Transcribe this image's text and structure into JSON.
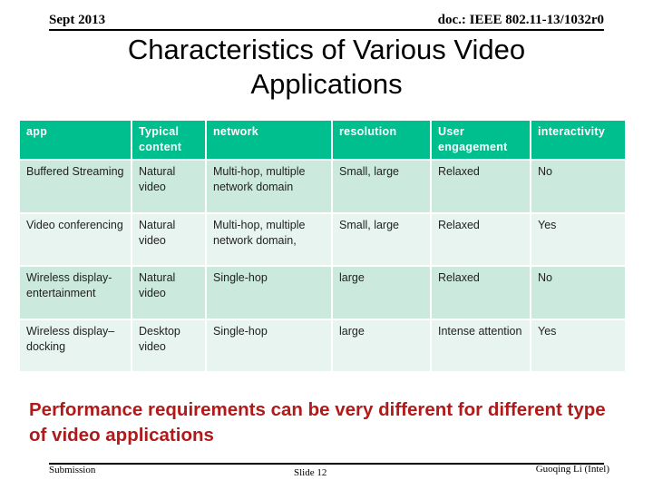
{
  "header": {
    "date": "Sept 2013",
    "doc_id": "doc.: IEEE 802.11-13/1032r0"
  },
  "title": "Characteristics of Various Video Applications",
  "table": {
    "columns": [
      "app",
      "Typical content",
      "network",
      "resolution",
      "User engagement",
      "interactivity"
    ],
    "rows": [
      [
        "Buffered Streaming",
        "Natural video",
        "Multi-hop, multiple network domain",
        "Small, large",
        "Relaxed",
        "No"
      ],
      [
        "Video conferencing",
        "Natural video",
        "Multi-hop, multiple network domain,",
        "Small, large",
        "Relaxed",
        "Yes"
      ],
      [
        "Wireless display-entertainment",
        "Natural video",
        "Single-hop",
        "large",
        "Relaxed",
        "No"
      ],
      [
        "Wireless display–docking",
        "Desktop video",
        "Single-hop",
        "large",
        "Intense attention",
        "Yes"
      ]
    ]
  },
  "callout": "Performance requirements can be very different for different type of video applications",
  "footer": {
    "left": "Submission",
    "center": "Slide 12",
    "right": "Guoqing Li (Intel)"
  },
  "colors": {
    "header_fill": "#00bf8f",
    "row_odd": "#cbe9dd",
    "row_even": "#e7f4ef",
    "callout_text": "#b01a1a"
  }
}
